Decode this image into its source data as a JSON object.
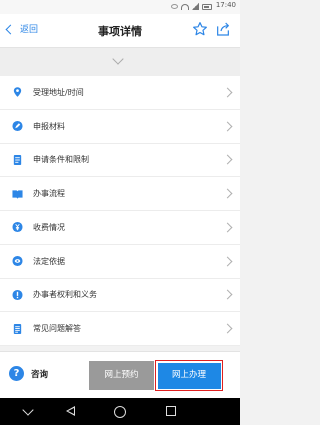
{
  "status_bar": {
    "time": "17:40",
    "icons": [
      "eye-icon",
      "wifi-icon",
      "signal-icon",
      "battery-icon"
    ]
  },
  "header": {
    "back_label": "返回",
    "title": "事项详情",
    "star_icon": "star-outline-icon",
    "share_icon": "share-icon"
  },
  "colors": {
    "accent": "#2d86e6",
    "primary_button": "#1e88e5",
    "secondary_button": "#9a9a9a",
    "highlight_border": "#e02020"
  },
  "items": [
    {
      "label": "受理地址/时间",
      "icon": "location-pin-icon"
    },
    {
      "label": "申报材料",
      "icon": "pen-circle-icon"
    },
    {
      "label": "申请条件和限制",
      "icon": "document-list-icon"
    },
    {
      "label": "办事流程",
      "icon": "book-open-icon"
    },
    {
      "label": "收费情况",
      "icon": "yen-circle-icon"
    },
    {
      "label": "法定依据",
      "icon": "law-circle-icon"
    },
    {
      "label": "办事者权利和义务",
      "icon": "exclamation-circle-icon"
    },
    {
      "label": "常见问题解答",
      "icon": "faq-document-icon"
    }
  ],
  "bottom": {
    "consult_label": "咨询",
    "consult_icon": "question-circle-icon",
    "reserve_button": "网上预约",
    "online_button": "网上办理"
  }
}
